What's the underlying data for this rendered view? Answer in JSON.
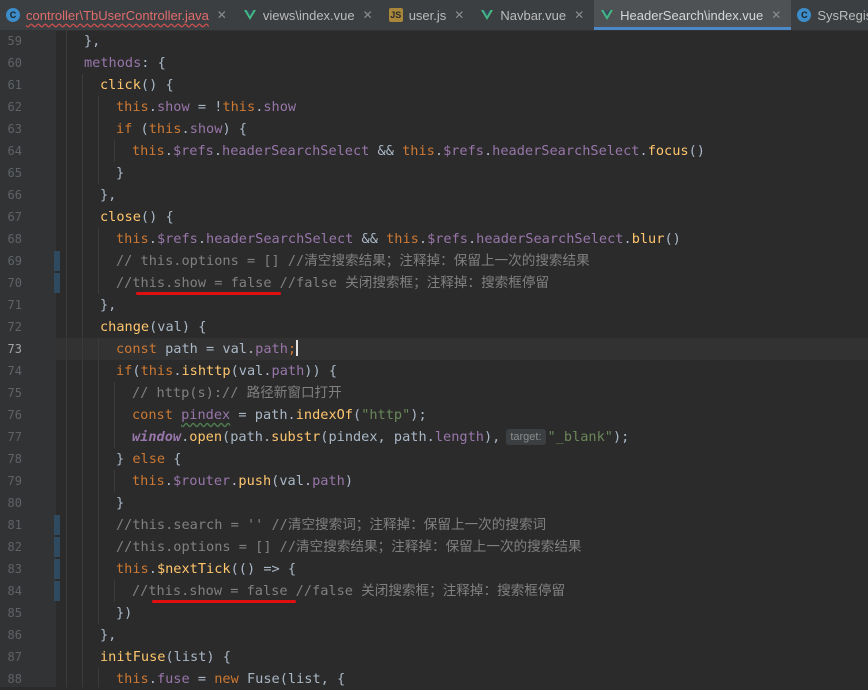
{
  "tabs": [
    {
      "label": "controller\\TbUserController.java",
      "icon": "java-class-icon",
      "error": true,
      "active": false,
      "closable": true
    },
    {
      "label": "views\\index.vue",
      "icon": "vue-file-icon",
      "error": false,
      "active": false,
      "closable": true
    },
    {
      "label": "user.js",
      "icon": "javascript-file-icon",
      "error": false,
      "active": false,
      "closable": true
    },
    {
      "label": "Navbar.vue",
      "icon": "vue-file-icon",
      "error": false,
      "active": false,
      "closable": true
    },
    {
      "label": "HeaderSearch\\index.vue",
      "icon": "vue-file-icon",
      "error": false,
      "active": true,
      "closable": true
    },
    {
      "label": "SysRegisterS",
      "icon": "java-class-icon",
      "error": false,
      "active": false,
      "closable": false
    }
  ],
  "editor": {
    "current_line": 73,
    "lines": [
      {
        "n": 59,
        "indent": 1,
        "tokens": [
          [
            "pl",
            "},"
          ]
        ]
      },
      {
        "n": 60,
        "indent": 1,
        "tokens": [
          [
            "prop",
            "methods"
          ],
          [
            "pl",
            ": {"
          ]
        ]
      },
      {
        "n": 61,
        "indent": 2,
        "tokens": [
          [
            "fn",
            "click"
          ],
          [
            "pl",
            "() {"
          ]
        ]
      },
      {
        "n": 62,
        "indent": 3,
        "tokens": [
          [
            "kw",
            "this"
          ],
          [
            "pl",
            "."
          ],
          [
            "prop",
            "show"
          ],
          [
            "pl",
            " = !"
          ],
          [
            "kw",
            "this"
          ],
          [
            "pl",
            "."
          ],
          [
            "prop",
            "show"
          ]
        ]
      },
      {
        "n": 63,
        "indent": 3,
        "tokens": [
          [
            "kw",
            "if"
          ],
          [
            "pl",
            " ("
          ],
          [
            "kw",
            "this"
          ],
          [
            "pl",
            "."
          ],
          [
            "prop",
            "show"
          ],
          [
            "pl",
            ") {"
          ]
        ]
      },
      {
        "n": 64,
        "indent": 4,
        "tokens": [
          [
            "kw",
            "this"
          ],
          [
            "pl",
            "."
          ],
          [
            "prop",
            "$refs"
          ],
          [
            "pl",
            "."
          ],
          [
            "prop",
            "headerSearchSelect"
          ],
          [
            "pl",
            " && "
          ],
          [
            "kw",
            "this"
          ],
          [
            "pl",
            "."
          ],
          [
            "prop",
            "$refs"
          ],
          [
            "pl",
            "."
          ],
          [
            "prop",
            "headerSearchSelect"
          ],
          [
            "pl",
            "."
          ],
          [
            "fn",
            "focus"
          ],
          [
            "pl",
            "()"
          ]
        ]
      },
      {
        "n": 65,
        "indent": 3,
        "tokens": [
          [
            "pl",
            "}"
          ]
        ]
      },
      {
        "n": 66,
        "indent": 2,
        "tokens": [
          [
            "pl",
            "},"
          ]
        ]
      },
      {
        "n": 67,
        "indent": 2,
        "tokens": [
          [
            "fn",
            "close"
          ],
          [
            "pl",
            "() {"
          ]
        ]
      },
      {
        "n": 68,
        "indent": 3,
        "tokens": [
          [
            "kw",
            "this"
          ],
          [
            "pl",
            "."
          ],
          [
            "prop",
            "$refs"
          ],
          [
            "pl",
            "."
          ],
          [
            "prop",
            "headerSearchSelect"
          ],
          [
            "pl",
            " && "
          ],
          [
            "kw",
            "this"
          ],
          [
            "pl",
            "."
          ],
          [
            "prop",
            "$refs"
          ],
          [
            "pl",
            "."
          ],
          [
            "prop",
            "headerSearchSelect"
          ],
          [
            "pl",
            "."
          ],
          [
            "fn",
            "blur"
          ],
          [
            "pl",
            "()"
          ]
        ]
      },
      {
        "n": 69,
        "indent": 3,
        "tokens": [
          [
            "cmt",
            "// this.options = [] //清空搜索结果；注释掉：保留上一次的搜索结果"
          ]
        ]
      },
      {
        "n": 70,
        "indent": 3,
        "tokens": [
          [
            "cmt",
            "//this.show = false //false 关闭搜索框；注释掉：搜索框停留"
          ]
        ]
      },
      {
        "n": 71,
        "indent": 2,
        "tokens": [
          [
            "pl",
            "},"
          ]
        ]
      },
      {
        "n": 72,
        "indent": 2,
        "tokens": [
          [
            "fn",
            "change"
          ],
          [
            "pl",
            "(val) {"
          ]
        ]
      },
      {
        "n": 73,
        "indent": 3,
        "tokens": [
          [
            "kw",
            "const"
          ],
          [
            "pl",
            " path = val."
          ],
          [
            "prop",
            "path"
          ],
          [
            "kw",
            ";"
          ]
        ]
      },
      {
        "n": 74,
        "indent": 3,
        "tokens": [
          [
            "kw",
            "if"
          ],
          [
            "pl",
            "("
          ],
          [
            "kw",
            "this"
          ],
          [
            "pl",
            "."
          ],
          [
            "fn",
            "ishttp"
          ],
          [
            "pl",
            "(val."
          ],
          [
            "prop",
            "path"
          ],
          [
            "pl",
            ")) {"
          ]
        ]
      },
      {
        "n": 75,
        "indent": 4,
        "tokens": [
          [
            "cmt",
            "// http(s):// 路径新窗口打开"
          ]
        ]
      },
      {
        "n": 76,
        "indent": 4,
        "tokens": [
          [
            "kw",
            "const"
          ],
          [
            "pl",
            " "
          ],
          [
            "unused",
            "pindex"
          ],
          [
            "pl",
            " = path."
          ],
          [
            "fn",
            "indexOf"
          ],
          [
            "pl",
            "("
          ],
          [
            "str",
            "\"http\""
          ],
          [
            "pl",
            ");"
          ]
        ]
      },
      {
        "n": 77,
        "indent": 4,
        "tokens": [
          [
            "glob",
            "window"
          ],
          [
            "pl",
            "."
          ],
          [
            "fn",
            "open"
          ],
          [
            "pl",
            "(path."
          ],
          [
            "fn",
            "substr"
          ],
          [
            "pl",
            "(pindex, path."
          ],
          [
            "prop",
            "length"
          ],
          [
            "pl",
            "),"
          ],
          [
            "hint",
            "target:"
          ],
          [
            "str",
            "\"_blank\""
          ],
          [
            "pl",
            ");"
          ]
        ]
      },
      {
        "n": 78,
        "indent": 3,
        "tokens": [
          [
            "pl",
            "} "
          ],
          [
            "kw",
            "else"
          ],
          [
            "pl",
            " {"
          ]
        ]
      },
      {
        "n": 79,
        "indent": 4,
        "tokens": [
          [
            "kw",
            "this"
          ],
          [
            "pl",
            "."
          ],
          [
            "prop",
            "$router"
          ],
          [
            "pl",
            "."
          ],
          [
            "fn",
            "push"
          ],
          [
            "pl",
            "(val."
          ],
          [
            "prop",
            "path"
          ],
          [
            "pl",
            ")"
          ]
        ]
      },
      {
        "n": 80,
        "indent": 3,
        "tokens": [
          [
            "pl",
            "}"
          ]
        ]
      },
      {
        "n": 81,
        "indent": 3,
        "tokens": [
          [
            "cmt",
            "//this.search = '' //清空搜索词；注释掉：保留上一次的搜索词"
          ]
        ]
      },
      {
        "n": 82,
        "indent": 3,
        "tokens": [
          [
            "cmt",
            "//this.options = [] //清空搜索结果；注释掉：保留上一次的搜索结果"
          ]
        ]
      },
      {
        "n": 83,
        "indent": 3,
        "tokens": [
          [
            "kw",
            "this"
          ],
          [
            "pl",
            "."
          ],
          [
            "fn",
            "$nextTick"
          ],
          [
            "pl",
            "(() => {"
          ]
        ]
      },
      {
        "n": 84,
        "indent": 4,
        "tokens": [
          [
            "cmt",
            "//this.show = false //false 关闭搜索框；注释掉：搜索框停留"
          ]
        ]
      },
      {
        "n": 85,
        "indent": 3,
        "tokens": [
          [
            "pl",
            "})"
          ]
        ]
      },
      {
        "n": 86,
        "indent": 2,
        "tokens": [
          [
            "pl",
            "},"
          ]
        ]
      },
      {
        "n": 87,
        "indent": 2,
        "tokens": [
          [
            "fn",
            "initFuse"
          ],
          [
            "pl",
            "(list) {"
          ]
        ]
      },
      {
        "n": 88,
        "indent": 3,
        "tokens": [
          [
            "kw",
            "this"
          ],
          [
            "pl",
            "."
          ],
          [
            "prop",
            "fuse"
          ],
          [
            "pl",
            " = "
          ],
          [
            "kw",
            "new"
          ],
          [
            "pl",
            " Fuse(list, {"
          ]
        ]
      }
    ]
  },
  "colors": {
    "keyword": "#cc7832",
    "function": "#ffc66d",
    "property": "#9876aa",
    "string": "#6a8759",
    "comment": "#808080",
    "text": "#a9b7c6",
    "annotation_underline": "#e01010",
    "active_tab_accent": "#4a88c7"
  }
}
